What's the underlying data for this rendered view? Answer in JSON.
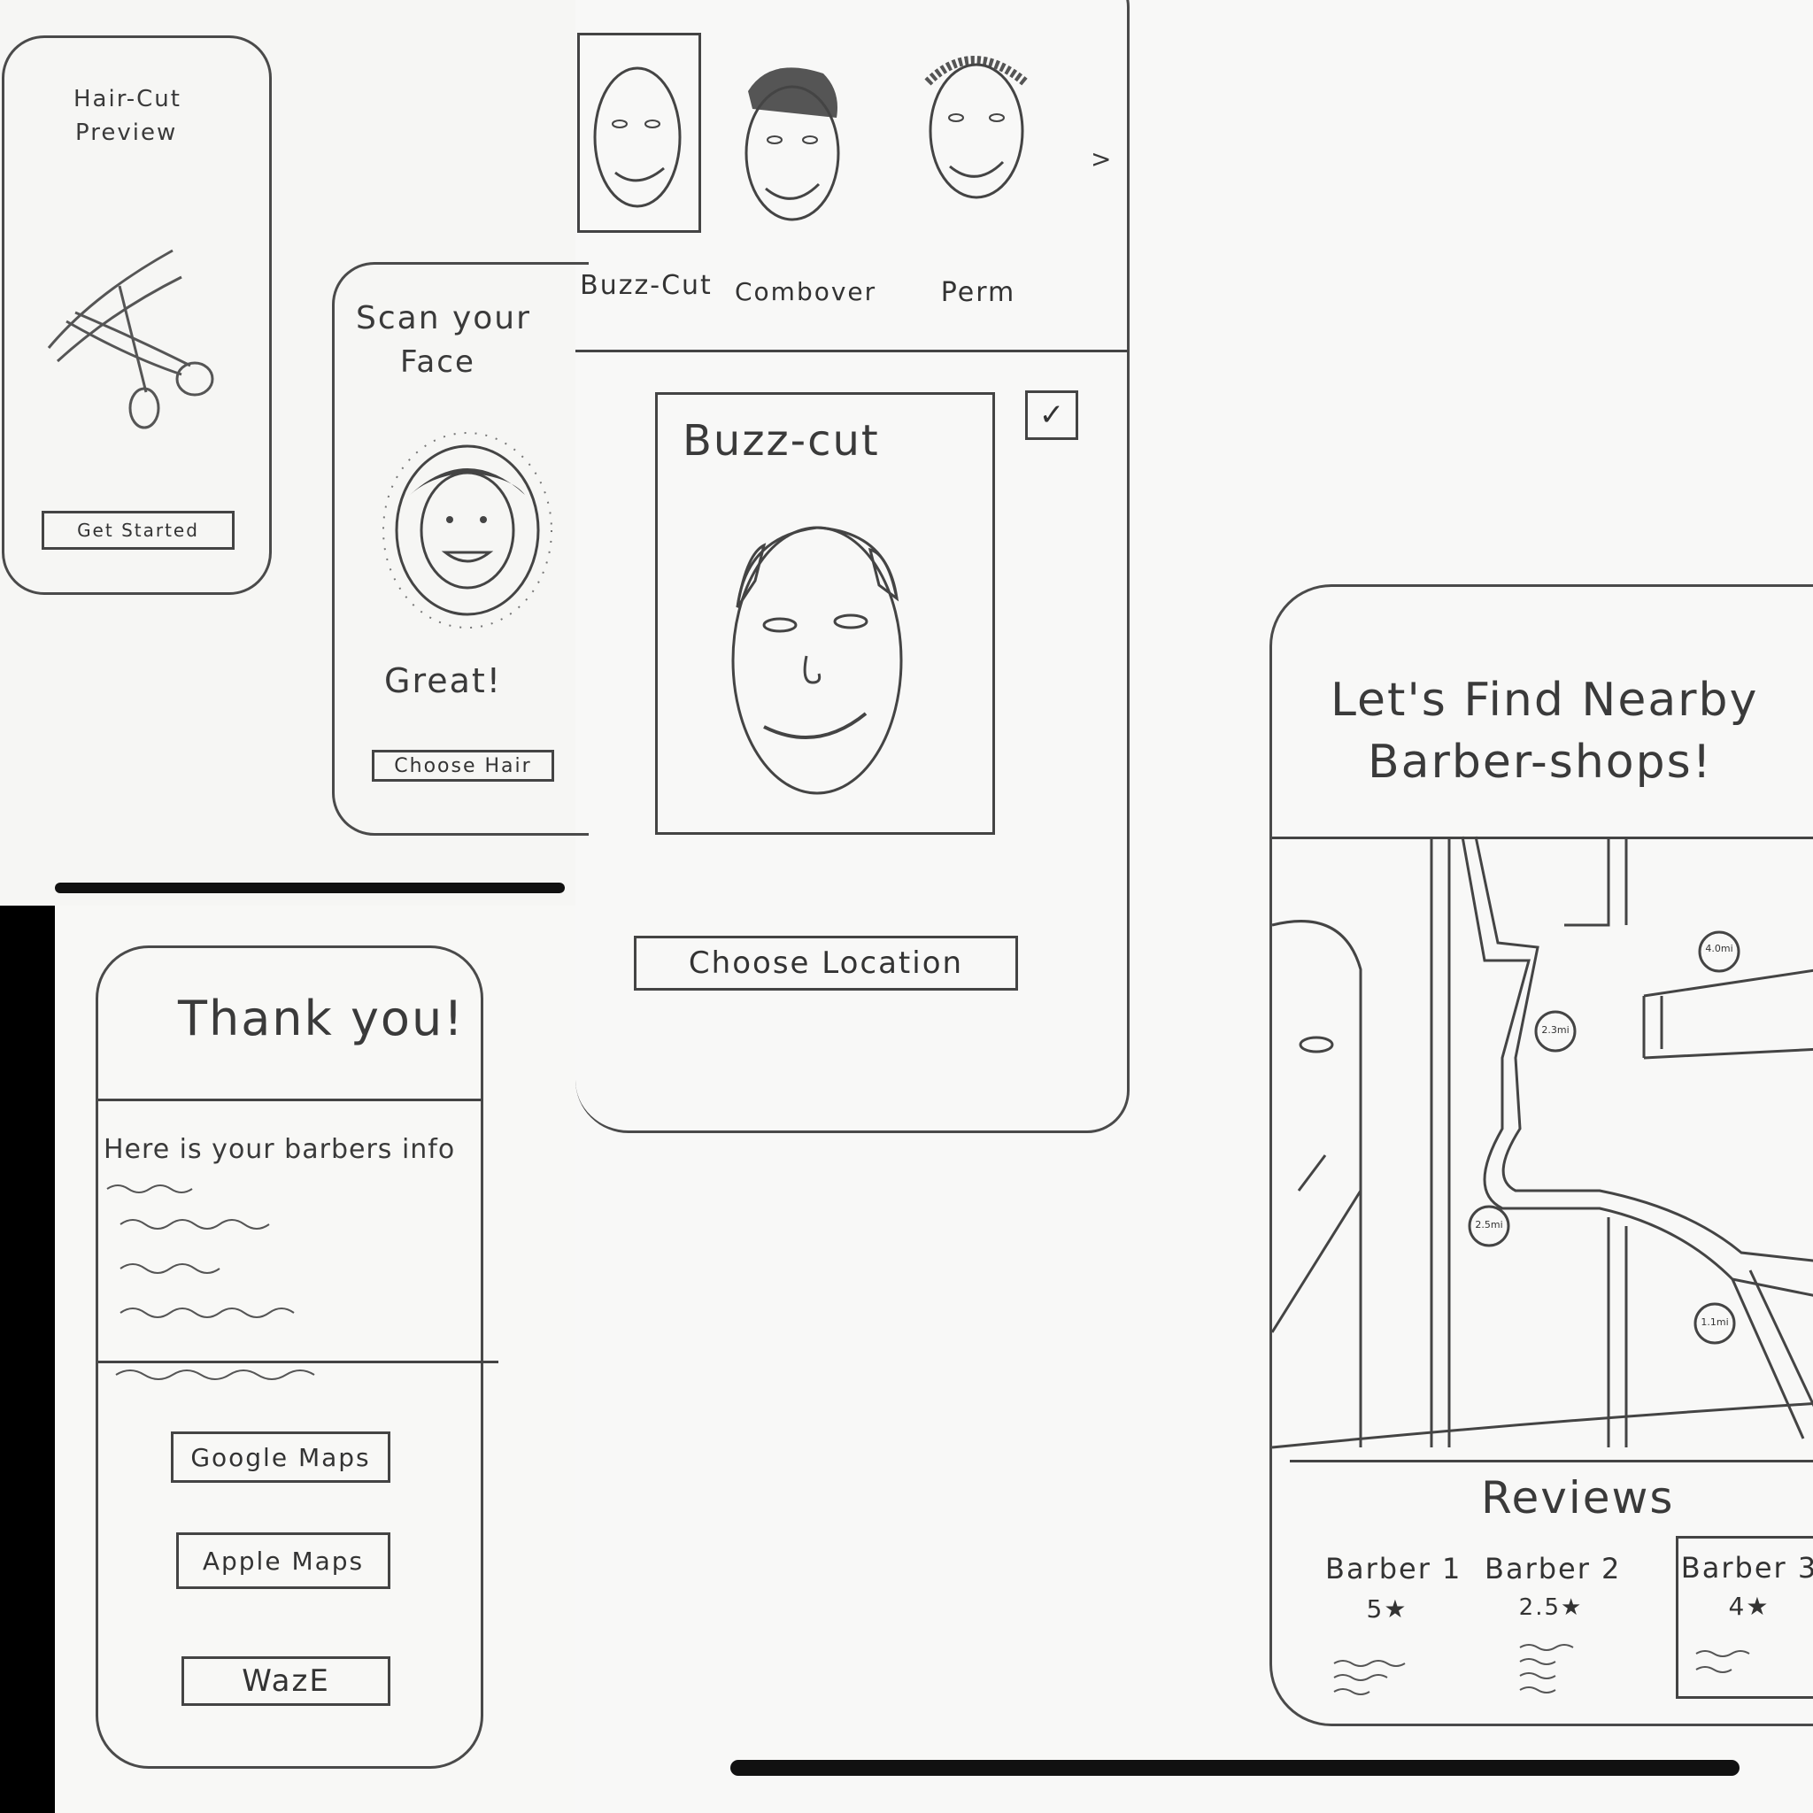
{
  "screen_welcome": {
    "title_line1": "Hair-Cut",
    "title_line2": "Preview",
    "get_started_label": "Get Started",
    "icon": "scissors-icon"
  },
  "screen_scan": {
    "title_line1": "Scan your",
    "title_line2": "Face",
    "status": "Great!",
    "choose_hair_label": "Choose Hair"
  },
  "screen_styles": {
    "styles": [
      {
        "label": "Buzz-Cut"
      },
      {
        "label": "Combover"
      },
      {
        "label": "Perm"
      }
    ],
    "selected_title": "Buzz-cut",
    "checkbox_mark": "✓",
    "next_arrow": ">",
    "choose_location_label": "Choose Location"
  },
  "screen_map": {
    "title_line1": "Let's Find Nearby",
    "title_line2": "Barber-shops!",
    "pins": [
      "4.0mi",
      "2.3mi",
      "2.5mi",
      "1.1mi"
    ],
    "reviews_title": "Reviews",
    "barbers": [
      {
        "name": "Barber 1",
        "rating": "5★"
      },
      {
        "name": "Barber 2",
        "rating": "2.5★"
      },
      {
        "name": "Barber 3",
        "rating": "4★"
      }
    ]
  },
  "screen_thanks": {
    "title": "Thank you!",
    "info_heading": "Here is your barbers info",
    "buttons": {
      "google": "Google Maps",
      "apple": "Apple Maps",
      "waze": "WazE"
    }
  }
}
